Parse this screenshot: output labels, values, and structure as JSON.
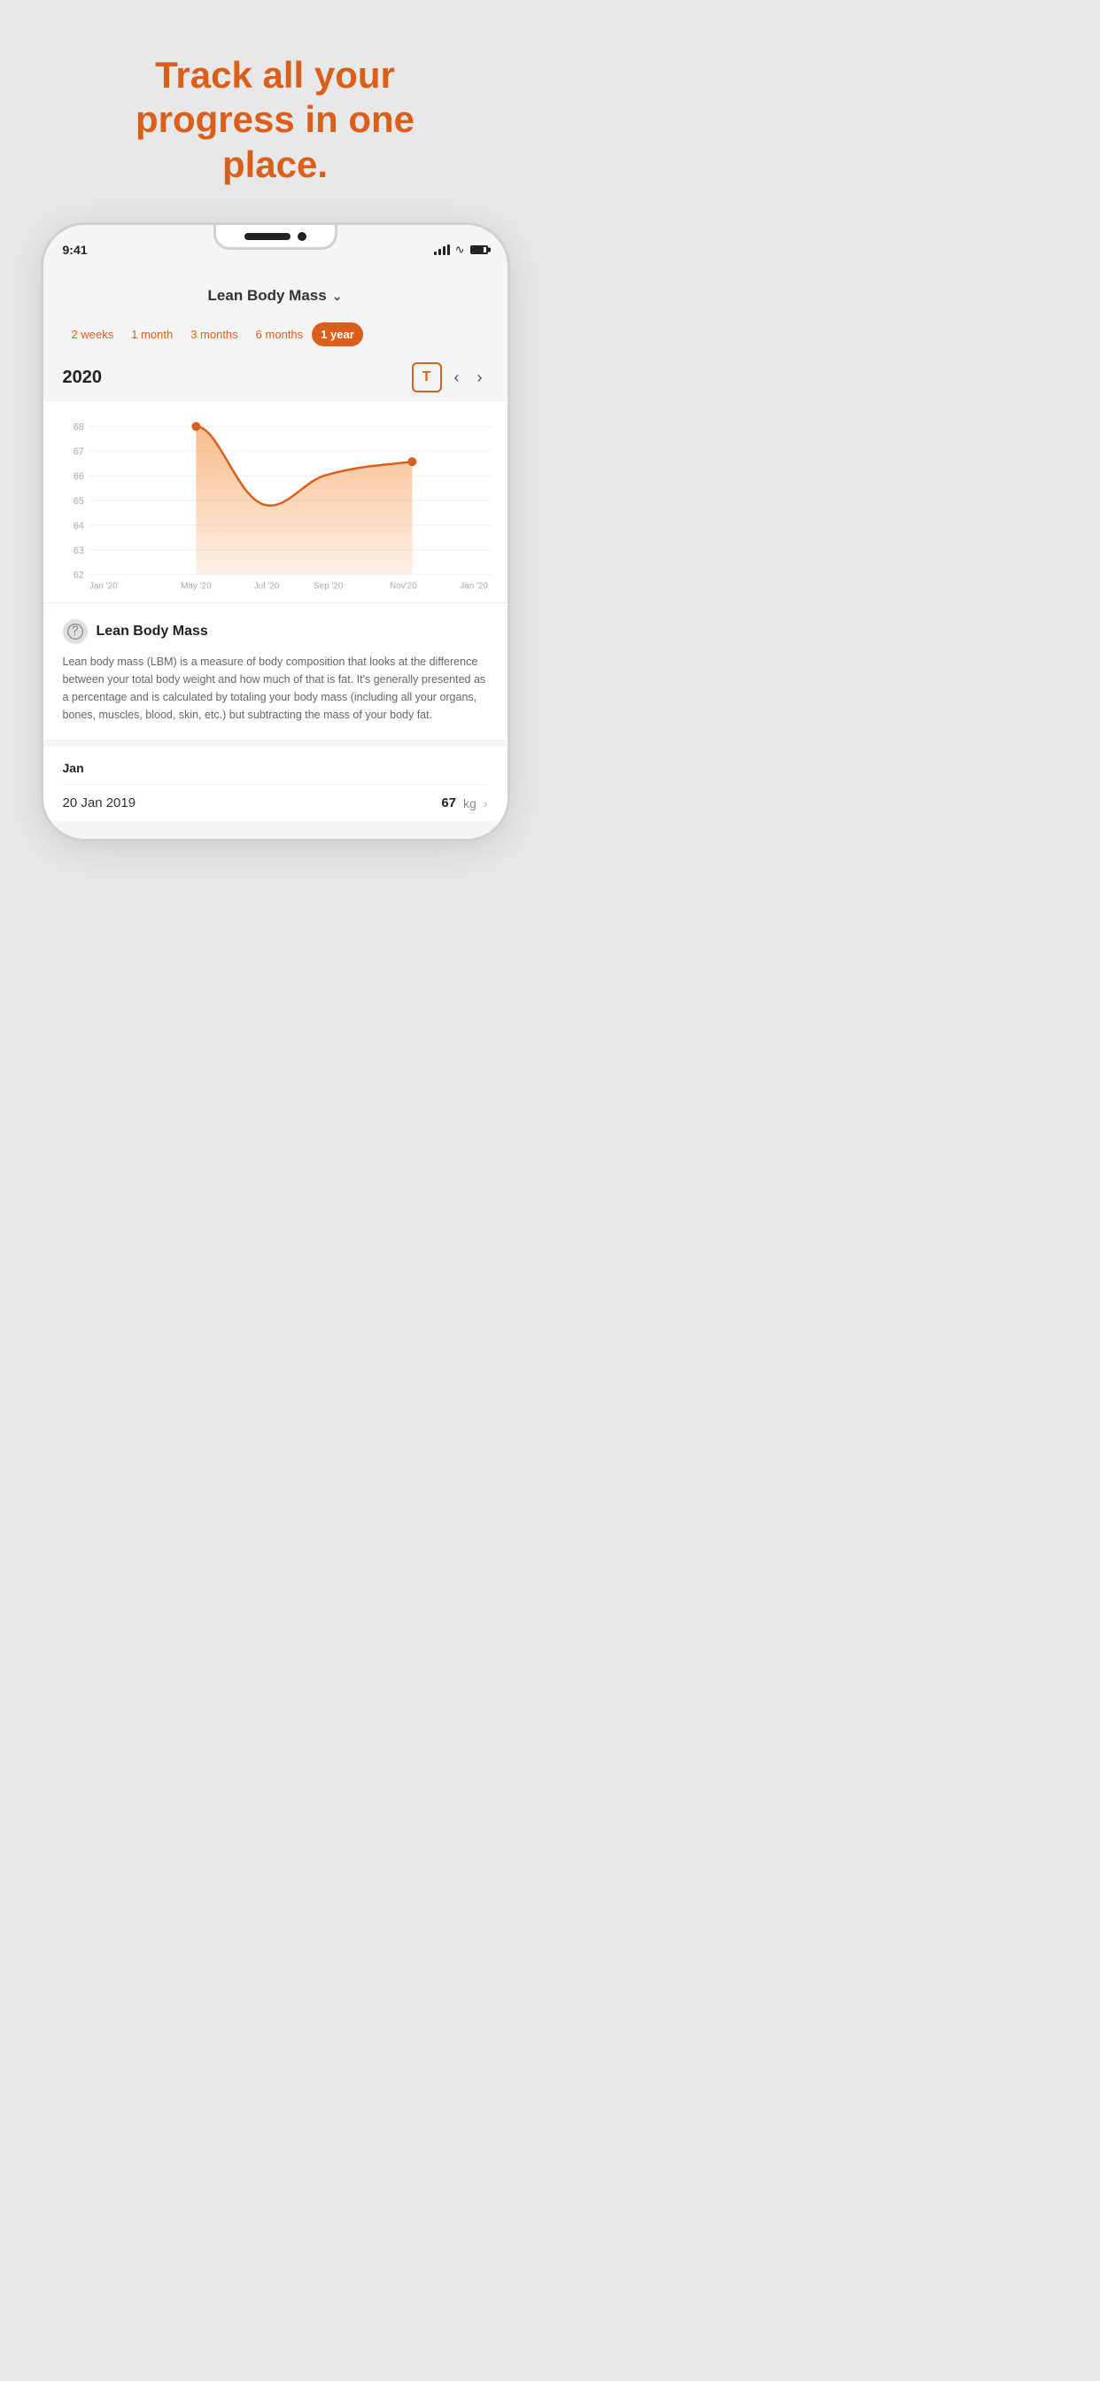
{
  "hero": {
    "line1": "Track all your",
    "line2": "progress in one",
    "line3": "place."
  },
  "status_bar": {
    "time": "9:41",
    "signal": "signal",
    "wifi": "wifi",
    "battery": "battery"
  },
  "screen": {
    "title": "Lean Body Mass",
    "chevron": "∨"
  },
  "time_filters": [
    {
      "label": "2 weeks",
      "active": false
    },
    {
      "label": "1 month",
      "active": false
    },
    {
      "label": "3 months",
      "active": false
    },
    {
      "label": "6 months",
      "active": false
    },
    {
      "label": "1 year",
      "active": true
    }
  ],
  "year": "2020",
  "t_button": "T",
  "chart": {
    "y_labels": [
      "68",
      "67",
      "66",
      "65",
      "64",
      "63",
      "62"
    ],
    "x_labels": [
      "Jan '20",
      "May '20",
      "Jul '20",
      "Sep '20",
      "Nov'20",
      "Jan '20"
    ]
  },
  "info": {
    "title": "Lean Body Mass",
    "icon": "🏃",
    "description": "Lean body mass (LBM) is a measure of body composition that looks at the difference between your total body weight and how much of that is fat. It's generally presented as a percentage and is calculated by totaling your body mass (including all your organs, bones, muscles, blood, skin, etc.) but subtracting the mass of your body fat."
  },
  "records": {
    "month": "Jan",
    "entries": [
      {
        "date": "20 Jan 2019",
        "value": "67",
        "unit": "kg"
      }
    ]
  }
}
